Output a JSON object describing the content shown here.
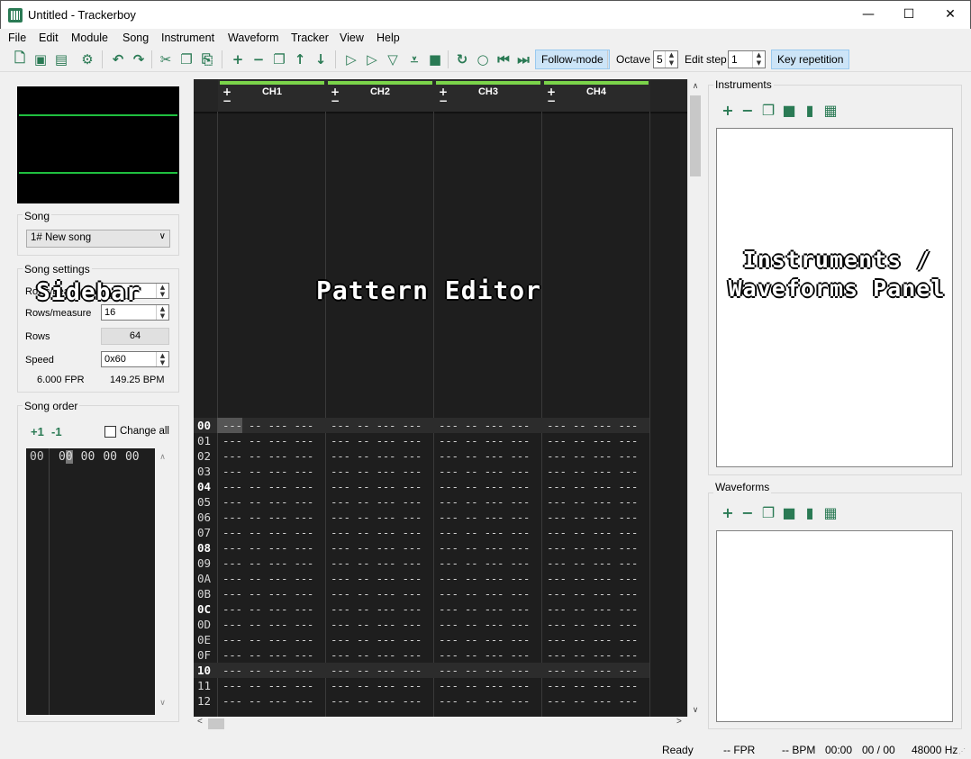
{
  "window": {
    "title": "Untitled - Trackerboy"
  },
  "menu": [
    "File",
    "Edit",
    "Module",
    "Song",
    "Instrument",
    "Waveform",
    "Tracker",
    "View",
    "Help"
  ],
  "toolbar": {
    "follow_mode": "Follow-mode",
    "octave_label": "Octave",
    "octave_value": "5",
    "edit_step_label": "Edit step",
    "edit_step_value": "1",
    "key_repetition": "Key repetition"
  },
  "sidebar": {
    "overlay_label": "Sidebar",
    "song_group": "Song",
    "song_select": "1# New song",
    "settings_group": "Song settings",
    "rows_per_beat_label": "Rows/beat",
    "rows_per_measure_label": "Rows/measure",
    "rows_per_measure_value": "16",
    "rows_label": "Rows",
    "rows_value": "64",
    "speed_label": "Speed",
    "speed_value": "0x60",
    "fpr": "6.000 FPR",
    "bpm": "149.25 BPM",
    "order_group": "Song order",
    "inc_label": "+1",
    "dec_label": "-1",
    "change_all": "Change all",
    "order_row": {
      "index": "00",
      "tracks": [
        "00",
        "00",
        "00",
        "00"
      ]
    }
  },
  "pattern": {
    "overlay_label": "Pattern Editor",
    "channels": [
      "CH1",
      "CH2",
      "CH3",
      "CH4"
    ],
    "row_numbers": [
      "00",
      "01",
      "02",
      "03",
      "04",
      "05",
      "06",
      "07",
      "08",
      "09",
      "0A",
      "0B",
      "0C",
      "0D",
      "0E",
      "0F",
      "10",
      "11",
      "12"
    ],
    "empty_cell": "--- -- --- ---"
  },
  "right_panel": {
    "overlay_label": "Instruments / Waveforms Panel",
    "instruments_group": "Instruments",
    "waveforms_group": "Waveforms"
  },
  "status": {
    "state": "Ready",
    "fpr": "-- FPR",
    "bpm": "-- BPM",
    "time": "00:00",
    "position": "00 / 00",
    "rate": "48000 Hz"
  },
  "colors": {
    "accent": "#2a7a54",
    "channel_bar": "#7bd44a",
    "scope_line": "#1fbf3f",
    "toggle_bg": "#cce4f7"
  }
}
